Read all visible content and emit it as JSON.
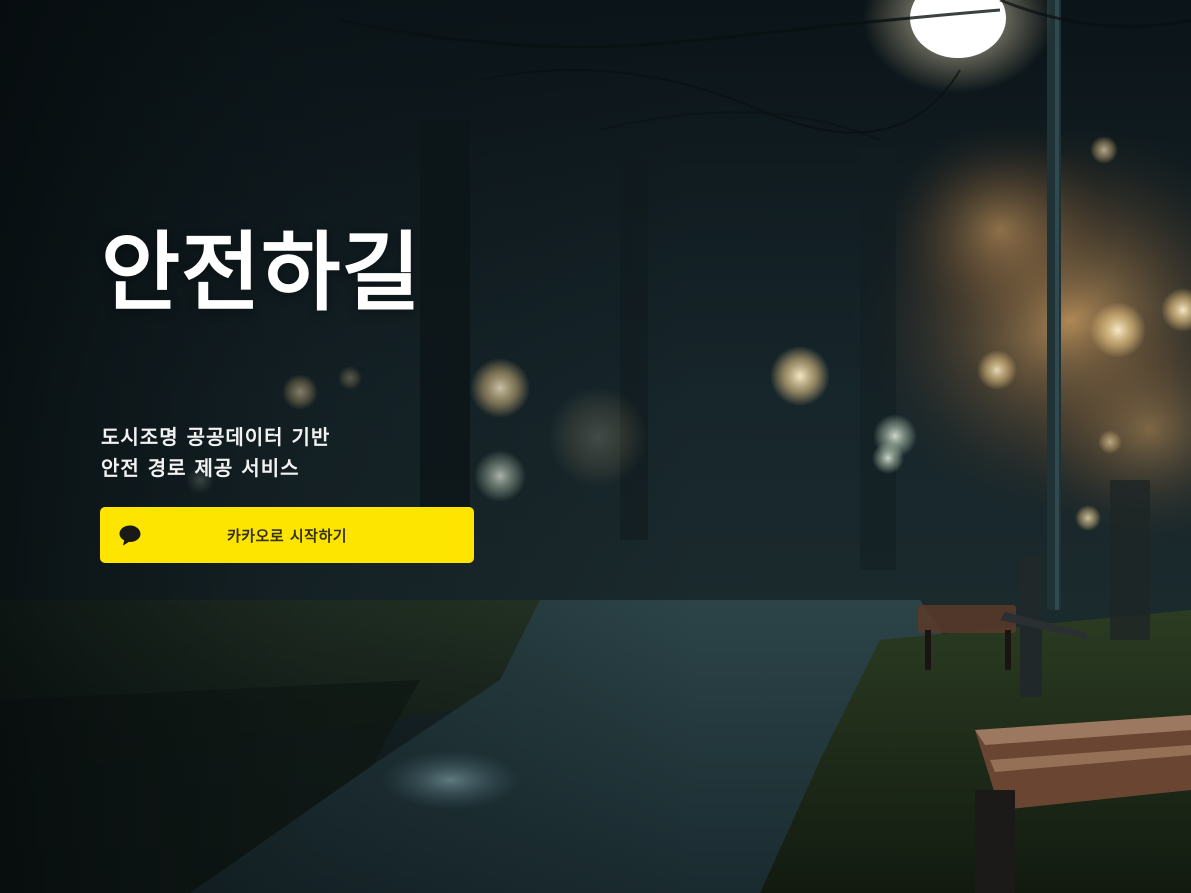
{
  "hero": {
    "title": "안전하길",
    "subtitle_line1": "도시조명 공공데이터 기반",
    "subtitle_line2": "안전 경로 제공 서비스"
  },
  "login": {
    "kakao_label": "카카오로 시작하기",
    "icon": "speech-bubble-icon"
  },
  "colors": {
    "kakao_yellow": "#FEE500",
    "kakao_text": "#191919",
    "title_text": "#FFFFFF"
  }
}
